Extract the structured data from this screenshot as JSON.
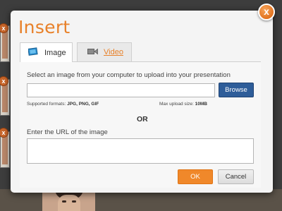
{
  "dialog": {
    "title": "Insert",
    "close_label": "x"
  },
  "tabs": [
    {
      "label": "Image",
      "icon": "image-icon",
      "active": true
    },
    {
      "label": "Video",
      "icon": "video-camera-icon",
      "active": false
    }
  ],
  "upload": {
    "instruction": "Select an image from your computer to upload into your presentation",
    "file_value": "",
    "browse_label": "Browse",
    "formats_label": "Supported formats:",
    "formats_value": "JPG, PNG, GIF",
    "max_label": "Max upload size:",
    "max_value": "10MB"
  },
  "separator": "OR",
  "url": {
    "label": "Enter the URL of the image",
    "value": ""
  },
  "actions": {
    "ok_label": "OK",
    "cancel_label": "Cancel"
  },
  "background": {
    "delete_label": "x"
  },
  "colors": {
    "accent": "#e8812a",
    "browse": "#2e5d99",
    "ok": "#f0882a"
  }
}
